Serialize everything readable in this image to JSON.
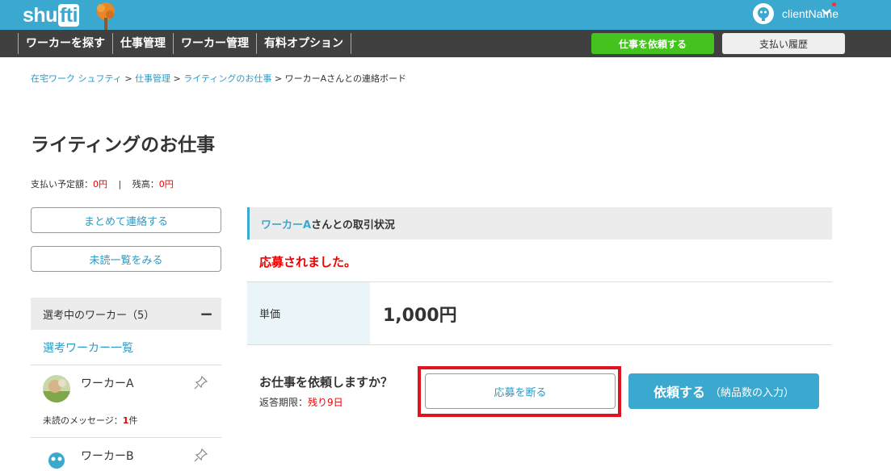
{
  "header": {
    "logo_text_a": "shu",
    "logo_text_b": "fti",
    "user_name": "clientName"
  },
  "nav": {
    "items": [
      "ワーカーを探す",
      "仕事管理",
      "ワーカー管理",
      "有料オプション"
    ],
    "request_button": "仕事を依頼する",
    "history_button": "支払い履歴"
  },
  "breadcrumb": {
    "items": [
      "在宅ワーク シュフティ",
      "仕事管理",
      "ライティングのお仕事"
    ],
    "separator": " > ",
    "current": "ワーカーAさんとの連絡ボード"
  },
  "page": {
    "title": "ライティングのお仕事",
    "payment_label": "支払い予定額：",
    "payment_value": "0円",
    "divider": "|",
    "balance_label": "残高：",
    "balance_value": "0円"
  },
  "sidebar": {
    "bulk_contact_button": "まとめて連絡する",
    "unread_list_button": "未読一覧をみる",
    "selecting_header": "選考中のワーカー（5）",
    "collapse_symbol": "−",
    "worker_list_link": "選考ワーカー一覧",
    "workers": [
      {
        "name": "ワーカーA",
        "unread_label": "未読のメッセージ：",
        "unread_count": "1",
        "unread_unit": "件"
      },
      {
        "name": "ワーカーB"
      }
    ]
  },
  "main": {
    "status_head_name": "ワーカーA",
    "status_head_suffix": "さんとの取引状況",
    "applied_message": "応募されました。",
    "price_label": "単価",
    "price_value": "1,000円",
    "ask_question": "お仕事を依頼しますか？",
    "deadline_label": "返答期限：",
    "deadline_value": "残り9日",
    "decline_button": "応募を断る",
    "order_button_main": "依頼する",
    "order_button_sub": "（納品数の入力）"
  },
  "colors": {
    "brand": "#3aa8cf",
    "nav_bg": "#404040",
    "accent_green": "#44c21e",
    "alert_red": "#e00000",
    "highlight_red": "#e0141e"
  }
}
